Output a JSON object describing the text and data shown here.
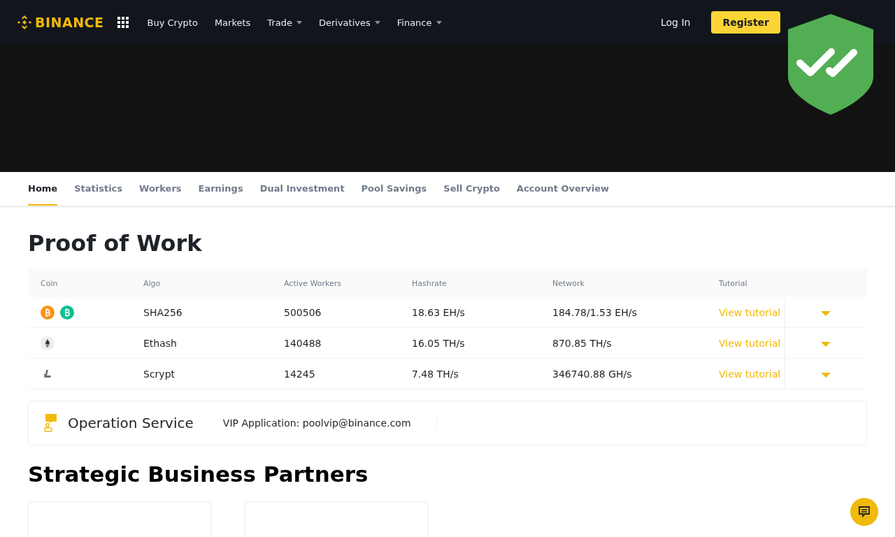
{
  "header": {
    "logo": "BINANCE",
    "nav": [
      {
        "label": "Buy Crypto",
        "has_menu": false
      },
      {
        "label": "Markets",
        "has_menu": false
      },
      {
        "label": "Trade",
        "has_menu": true
      },
      {
        "label": "Derivatives",
        "has_menu": true
      },
      {
        "label": "Finance",
        "has_menu": true
      }
    ],
    "login": "Log In",
    "register": "Register"
  },
  "tabs": [
    {
      "label": "Home",
      "selected": true
    },
    {
      "label": "Statistics",
      "selected": false
    },
    {
      "label": "Workers",
      "selected": false
    },
    {
      "label": "Earnings",
      "selected": false
    },
    {
      "label": "Dual Investment",
      "selected": false
    },
    {
      "label": "Pool Savings",
      "selected": false
    },
    {
      "label": "Sell Crypto",
      "selected": false
    },
    {
      "label": "Account Overview",
      "selected": false
    }
  ],
  "title": "Proof of Work",
  "table": {
    "columns": [
      "Coin",
      "Algo",
      "Active Workers",
      "Hashrate",
      "Network",
      "Tutorial"
    ],
    "rows": [
      {
        "coins": [
          {
            "kind": "btc"
          },
          {
            "kind": "bch"
          }
        ],
        "algo": "SHA256",
        "workers": "500506",
        "hashrate": "18.63 EH/s",
        "network": "184.78/1.53 EH/s",
        "tutorial": "View tutorial"
      },
      {
        "coins": [
          {
            "kind": "eth"
          }
        ],
        "algo": "Ethash",
        "workers": "140488",
        "hashrate": "16.05 TH/s",
        "network": "870.85 TH/s",
        "tutorial": "View tutorial"
      },
      {
        "coins": [
          {
            "kind": "ltc"
          }
        ],
        "algo": "Scrypt",
        "workers": "14245",
        "hashrate": "7.48 TH/s",
        "network": "346740.88 GH/s",
        "tutorial": "View tutorial"
      }
    ]
  },
  "service": {
    "title": "Operation Service",
    "contact": "VIP Application: poolvip@binance.com"
  },
  "partners_title": "Strategic Business Partners"
}
